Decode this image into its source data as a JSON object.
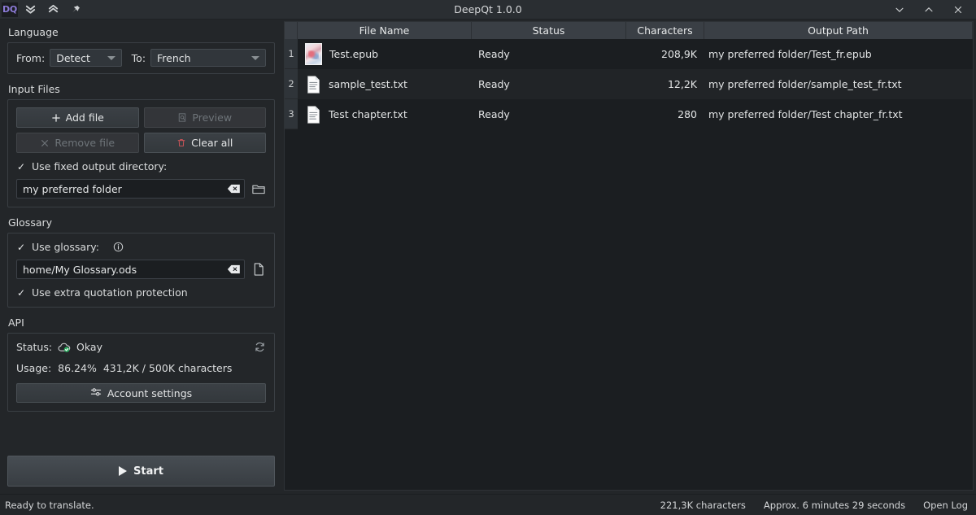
{
  "titlebar": {
    "logo": "DQ",
    "title": "DeepQt 1.0.0",
    "collapse_all_icon": "chevrons-down-icon",
    "expand_all_icon": "chevrons-up-icon",
    "pin_icon": "pin-icon",
    "minimize_label": "⌄",
    "maximize_label": "⌃",
    "close_label": "✕"
  },
  "language": {
    "section_title": "Language",
    "from_label": "From:",
    "from_value": "Detect",
    "to_label": "To:",
    "to_value": "French"
  },
  "input_files": {
    "section_title": "Input Files",
    "add_file_label": "Add file",
    "preview_label": "Preview",
    "remove_file_label": "Remove file",
    "clear_all_label": "Clear all",
    "use_fixed_output_label": "Use fixed output directory:",
    "use_fixed_output_checked": "✓",
    "output_dir_value": "my preferred folder",
    "clear_icon": "clear-field-icon",
    "browse_icon": "folder-icon"
  },
  "glossary": {
    "section_title": "Glossary",
    "use_glossary_label": "Use glossary:",
    "use_glossary_checked": "✓",
    "info_icon": "info-icon",
    "glossary_path_value": "home/My Glossary.ods",
    "clear_icon": "clear-field-icon",
    "browse_icon": "file-icon",
    "extra_quotation_label": "Use extra quotation protection",
    "extra_quotation_checked": "✓"
  },
  "api": {
    "section_title": "API",
    "status_label": "Status:",
    "status_value": "Okay",
    "status_icon": "cloud-ok-icon",
    "status_color": "#2eae62",
    "refresh_icon": "refresh-icon",
    "usage_label": "Usage:",
    "usage_percent": "86.24%",
    "usage_value": "431,2K / 500K characters",
    "account_settings_label": "Account settings",
    "account_settings_icon": "sliders-icon"
  },
  "start": {
    "label": "Start",
    "icon": "play-icon"
  },
  "table": {
    "columns": [
      "File Name",
      "Status",
      "Characters",
      "Output Path"
    ],
    "rows": [
      {
        "index": "1",
        "icon": "epub-cover-thumbnail",
        "file_name": "Test.epub",
        "status": "Ready",
        "characters": "208,9K",
        "output_path": "my preferred folder/Test_fr.epub"
      },
      {
        "index": "2",
        "icon": "text-document-icon",
        "file_name": "sample_test.txt",
        "status": "Ready",
        "characters": "12,2K",
        "output_path": "my preferred folder/sample_test_fr.txt"
      },
      {
        "index": "3",
        "icon": "text-document-icon",
        "file_name": "Test chapter.txt",
        "status": "Ready",
        "characters": "280",
        "output_path": "my preferred folder/Test chapter_fr.txt"
      }
    ]
  },
  "statusbar": {
    "message": "Ready to translate.",
    "characters": "221,3K characters",
    "estimate": "Approx. 6 minutes 29 seconds",
    "open_log_label": "Open Log"
  }
}
